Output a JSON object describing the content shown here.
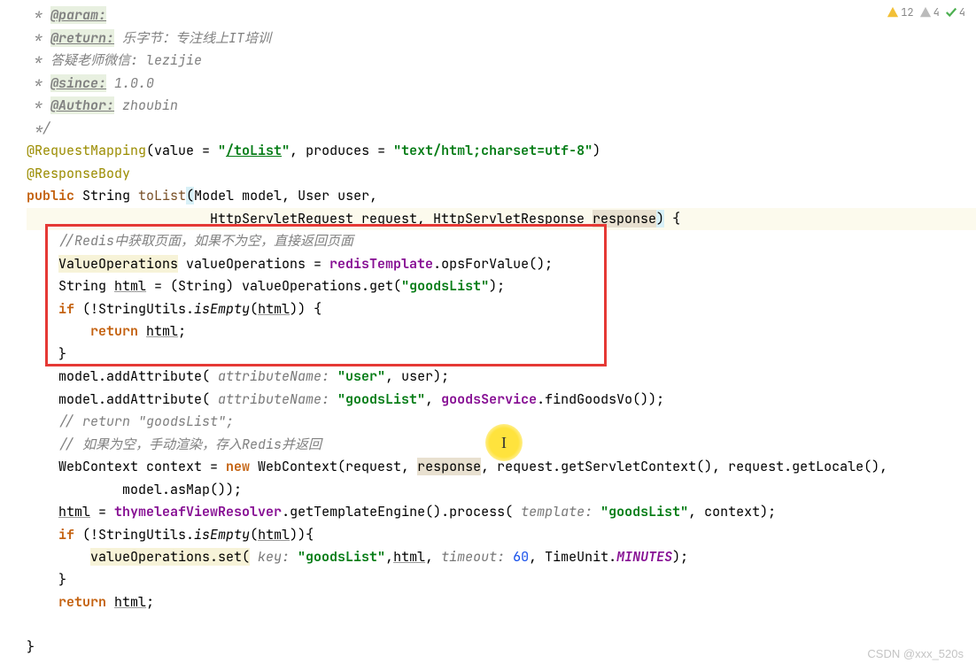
{
  "badges": {
    "warn": "12",
    "typo": "4",
    "check": "4"
  },
  "doc": {
    "param": "@param:",
    "return": "@return:",
    "returnText": " 乐字节：专注线上IT培训",
    "line3": " * 答疑老师微信: lezijie",
    "since": "@since:",
    "sinceText": " 1.0.0",
    "author": "@Author:",
    "authorText": " zhoubin",
    "close": " */"
  },
  "code": {
    "anno1a": "@RequestMapping",
    "anno1b": "(value = ",
    "anno1c": "\"",
    "anno1d": "/toList",
    "anno1e": "\"",
    "anno1f": ", produces = ",
    "anno1g": "\"text/html;charset=utf-8\"",
    "anno1h": ")",
    "anno2": "@ResponseBody",
    "sig1_public": "public",
    "sig1_rest": " String ",
    "sig1_method": "toList",
    "sig1_paren": "(",
    "sig1_params": "Model model, User user,",
    "sig2_params": "HttpServletRequest request, HttpServletResponse ",
    "sig2_resp": "response",
    "sig2_close": ")",
    "sig2_brace": " {",
    "c1": "//Redis",
    "c1b": "中获取页面，如果不为空，直接返回页面",
    "l1a": "ValueOperations",
    "l1b": " valueOperations = ",
    "l1c": "redisTemplate",
    "l1d": ".opsForValue();",
    "l2a": "String ",
    "l2b": "html",
    "l2c": " = (String) valueOperations.get(",
    "l2d": "\"goodsList\"",
    "l2e": ");",
    "l3a": "if",
    "l3b": " (!StringUtils.",
    "l3c": "isEmpty",
    "l3d": "(",
    "l3e": "html",
    "l3f": ")) {",
    "l4a": "return",
    "l4b": " ",
    "l4c": "html",
    "l4d": ";",
    "l5": "}",
    "l6a": "model.addAttribute(",
    "l6hint": " attributeName: ",
    "l6b": "\"user\"",
    "l6c": ", user);",
    "l7a": "model.addAttribute(",
    "l7hint": " attributeName: ",
    "l7b": "\"goodsList\"",
    "l7c": ", ",
    "l7d": "goodsService",
    "l7e": ".findGoodsVo());",
    "c2": "// return \"goodsList\";",
    "c3a": "// ",
    "c3b": "如果为空，手动渲染，存入Redis",
    "c3c": "并返回",
    "l8a": "WebContext context = ",
    "l8b": "new",
    "l8c": " WebContext(request, ",
    "l8d": "response",
    "l8e": ", request.getServletContext(), request.getLocale(),",
    "l9a": "model.asMap());",
    "l10a": "html",
    "l10b": " = ",
    "l10c": "thymeleafViewResolver",
    "l10d": ".getTemplateEngine().process(",
    "l10hint": " template: ",
    "l10e": "\"goodsList\"",
    "l10f": ", context);",
    "l11a": "if",
    "l11b": " (!StringUtils.",
    "l11c": "isEmpty",
    "l11d": "(",
    "l11e": "html",
    "l11f": ")){",
    "l12a": "valueOperations.set(",
    "l12hint1": " key: ",
    "l12b": "\"goodsList\"",
    "l12c": ",",
    "l12d": "html",
    "l12e": ",",
    "l12hint2": " timeout: ",
    "l12f": "60",
    "l12g": ", TimeUnit.",
    "l12h": "MINUTES",
    "l12i": ");",
    "l13": "}",
    "l14a": "return",
    "l14b": " ",
    "l14c": "html",
    "l14d": ";",
    "l15": "}"
  },
  "watermark": "CSDN @xxx_520s",
  "cursor_glyph": "I"
}
